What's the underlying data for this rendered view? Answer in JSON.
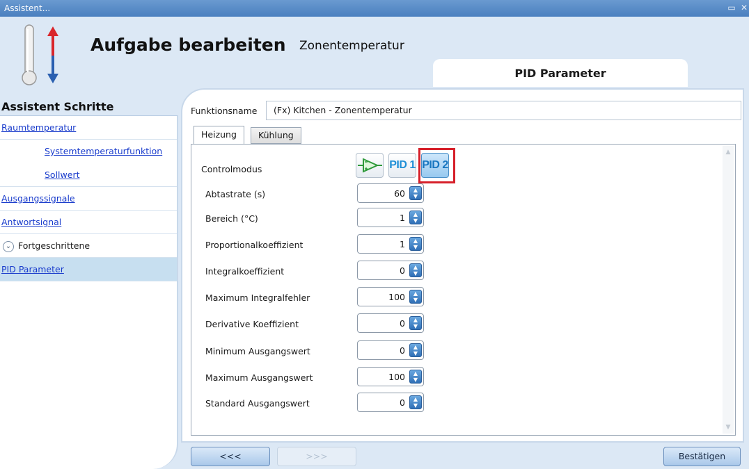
{
  "window": {
    "title": "Assistent..."
  },
  "header": {
    "title": "Aufgabe bearbeiten",
    "subtitle": "Zonentemperatur",
    "section_tab": "PID Parameter"
  },
  "sidebar": {
    "heading": "Assistent Schritte",
    "items": [
      {
        "label": "Raumtemperatur",
        "type": "link",
        "indent": 0
      },
      {
        "label": "Systemtemperaturfunktion",
        "type": "link",
        "indent": 2
      },
      {
        "label": "Sollwert",
        "type": "link",
        "indent": 2
      },
      {
        "label": "Ausgangssignale",
        "type": "link",
        "indent": 0
      },
      {
        "label": "Antwortsignal",
        "type": "link",
        "indent": 0
      },
      {
        "label": "Fortgeschrittene",
        "type": "group",
        "indent": 0
      },
      {
        "label": "PID Parameter",
        "type": "link",
        "indent": 0,
        "selected": true
      }
    ]
  },
  "main": {
    "function_name_label": "Funktionsname",
    "function_name_value": "(Fx) Kitchen - Zonentemperatur",
    "tabs": [
      {
        "label": "Heizung",
        "active": true
      },
      {
        "label": "Kühlung",
        "active": false
      }
    ],
    "control_mode": {
      "label": "Controlmodus",
      "options": [
        {
          "label": "",
          "icon": "amplifier-icon",
          "selected": false
        },
        {
          "label": "PID 1",
          "selected": false
        },
        {
          "label": "PID 2",
          "selected": true
        }
      ]
    },
    "params": [
      {
        "label": "Abtastrate (s)",
        "value": "60"
      },
      {
        "label": "Bereich (°C)",
        "value": "1"
      },
      {
        "label": "Proportionalkoeffizient",
        "value": "1"
      },
      {
        "label": "Integralkoeffizient",
        "value": "0"
      },
      {
        "label": "Maximum Integralfehler",
        "value": "100"
      },
      {
        "label": "Derivative Koeffizient",
        "value": "0"
      },
      {
        "label": "Minimum Ausgangswert",
        "value": "0"
      },
      {
        "label": "Maximum Ausgangswert",
        "value": "100"
      },
      {
        "label": "Standard Ausgangswert",
        "value": "0"
      }
    ]
  },
  "footer": {
    "back_label": "<<<",
    "next_label": ">>>",
    "confirm_label": "Bestätigen"
  },
  "colors": {
    "accent": "#4a7fbf",
    "highlight": "#d6202a",
    "link": "#1a3ccc"
  }
}
